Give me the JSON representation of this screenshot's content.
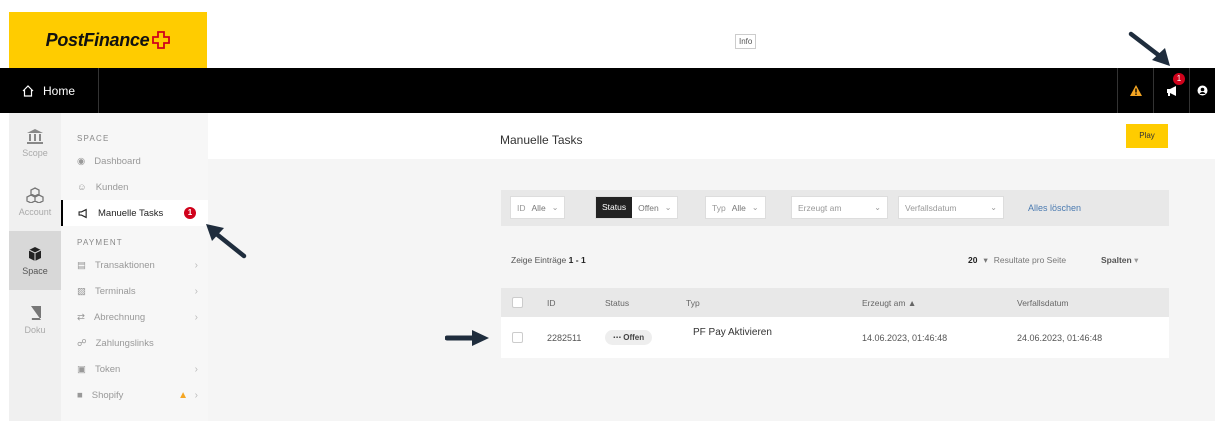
{
  "header": {
    "logo_text": "PostFinance",
    "info_label": "Info"
  },
  "navbar": {
    "home_label": "Home",
    "notification_count": "1"
  },
  "rail": [
    {
      "label": "Scope",
      "icon": "bank-icon"
    },
    {
      "label": "Account",
      "icon": "cubes-icon"
    },
    {
      "label": "Space",
      "icon": "cube-icon"
    },
    {
      "label": "Doku",
      "icon": "book-icon"
    }
  ],
  "sidebar": {
    "space_title": "SPACE",
    "payment_title": "PAYMENT",
    "space_items": [
      {
        "label": "Dashboard"
      },
      {
        "label": "Kunden"
      },
      {
        "label": "Manuelle Tasks",
        "badge": "1"
      }
    ],
    "payment_items": [
      {
        "label": "Transaktionen"
      },
      {
        "label": "Terminals"
      },
      {
        "label": "Abrechnung"
      },
      {
        "label": "Zahlungslinks"
      },
      {
        "label": "Token"
      },
      {
        "label": "Shopify"
      }
    ]
  },
  "main": {
    "title": "Manuelle Tasks",
    "play_label": "Play",
    "filters": {
      "id_label": "ID",
      "id_value": "Alle",
      "status_label": "Status",
      "status_value": "Offen",
      "typ_label": "Typ",
      "typ_value": "Alle",
      "created_label": "Erzeugt am",
      "due_label": "Verfallsdatum",
      "clear_label": "Alles löschen"
    },
    "count_prefix": "Zeige Einträge",
    "count_value": "1 - 1",
    "per_page_value": "20",
    "per_page_label": "Resultate pro Seite",
    "columns_label": "Spalten",
    "table": {
      "headers": [
        "ID",
        "Status",
        "Typ",
        "Erzeugt am ▲",
        "Verfallsdatum"
      ],
      "rows": [
        {
          "id": "2282511",
          "status": "Offen",
          "typ": "PF Pay Aktivieren",
          "created": "14.06.2023, 01:46:48",
          "due": "24.06.2023, 01:46:48"
        }
      ]
    }
  },
  "colors": {
    "brand_yellow": "#ffcc00",
    "nav_black": "#000000",
    "badge_red": "#d0021b",
    "warning_orange": "#f5a623"
  }
}
